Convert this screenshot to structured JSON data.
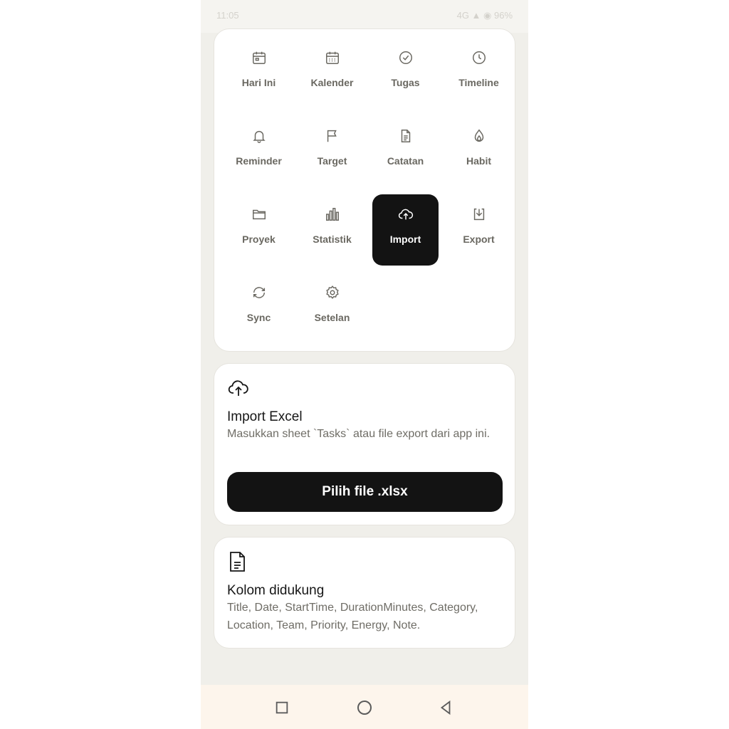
{
  "status": {
    "time": "11:05",
    "indicators": "4G ▲ ◉ 96%"
  },
  "menu": {
    "items": [
      {
        "label": "Hari Ini",
        "icon": "calendar-day-icon"
      },
      {
        "label": "Kalender",
        "icon": "calendar-month-icon"
      },
      {
        "label": "Tugas",
        "icon": "check-circle-icon"
      },
      {
        "label": "Timeline",
        "icon": "clock-icon"
      },
      {
        "label": "Reminder",
        "icon": "bell-icon"
      },
      {
        "label": "Target",
        "icon": "flag-icon"
      },
      {
        "label": "Catatan",
        "icon": "document-icon"
      },
      {
        "label": "Habit",
        "icon": "flame-icon"
      },
      {
        "label": "Proyek",
        "icon": "folder-icon"
      },
      {
        "label": "Statistik",
        "icon": "bar-chart-icon"
      },
      {
        "label": "Import",
        "icon": "cloud-upload-icon",
        "active": true
      },
      {
        "label": "Export",
        "icon": "download-icon"
      },
      {
        "label": "Sync",
        "icon": "sync-icon"
      },
      {
        "label": "Setelan",
        "icon": "gear-icon"
      }
    ]
  },
  "import_card": {
    "icon": "cloud-upload-icon",
    "title": "Import Excel",
    "description": "Masukkan sheet `Tasks` atau file export dari app ini.",
    "button_label": "Pilih file .xlsx"
  },
  "columns_card": {
    "icon": "document-icon",
    "title": "Kolom didukung",
    "description": "Title, Date, StartTime, DurationMinutes, Category, Location, Team, Priority, Energy, Note."
  },
  "navbar": {
    "icons": [
      "recent-apps-icon",
      "home-icon",
      "back-icon"
    ]
  },
  "colors": {
    "background": "#f0efea",
    "card": "#ffffff",
    "accent": "#131313",
    "muted_text": "#6a6861",
    "navbar": "#fdf5ec"
  }
}
